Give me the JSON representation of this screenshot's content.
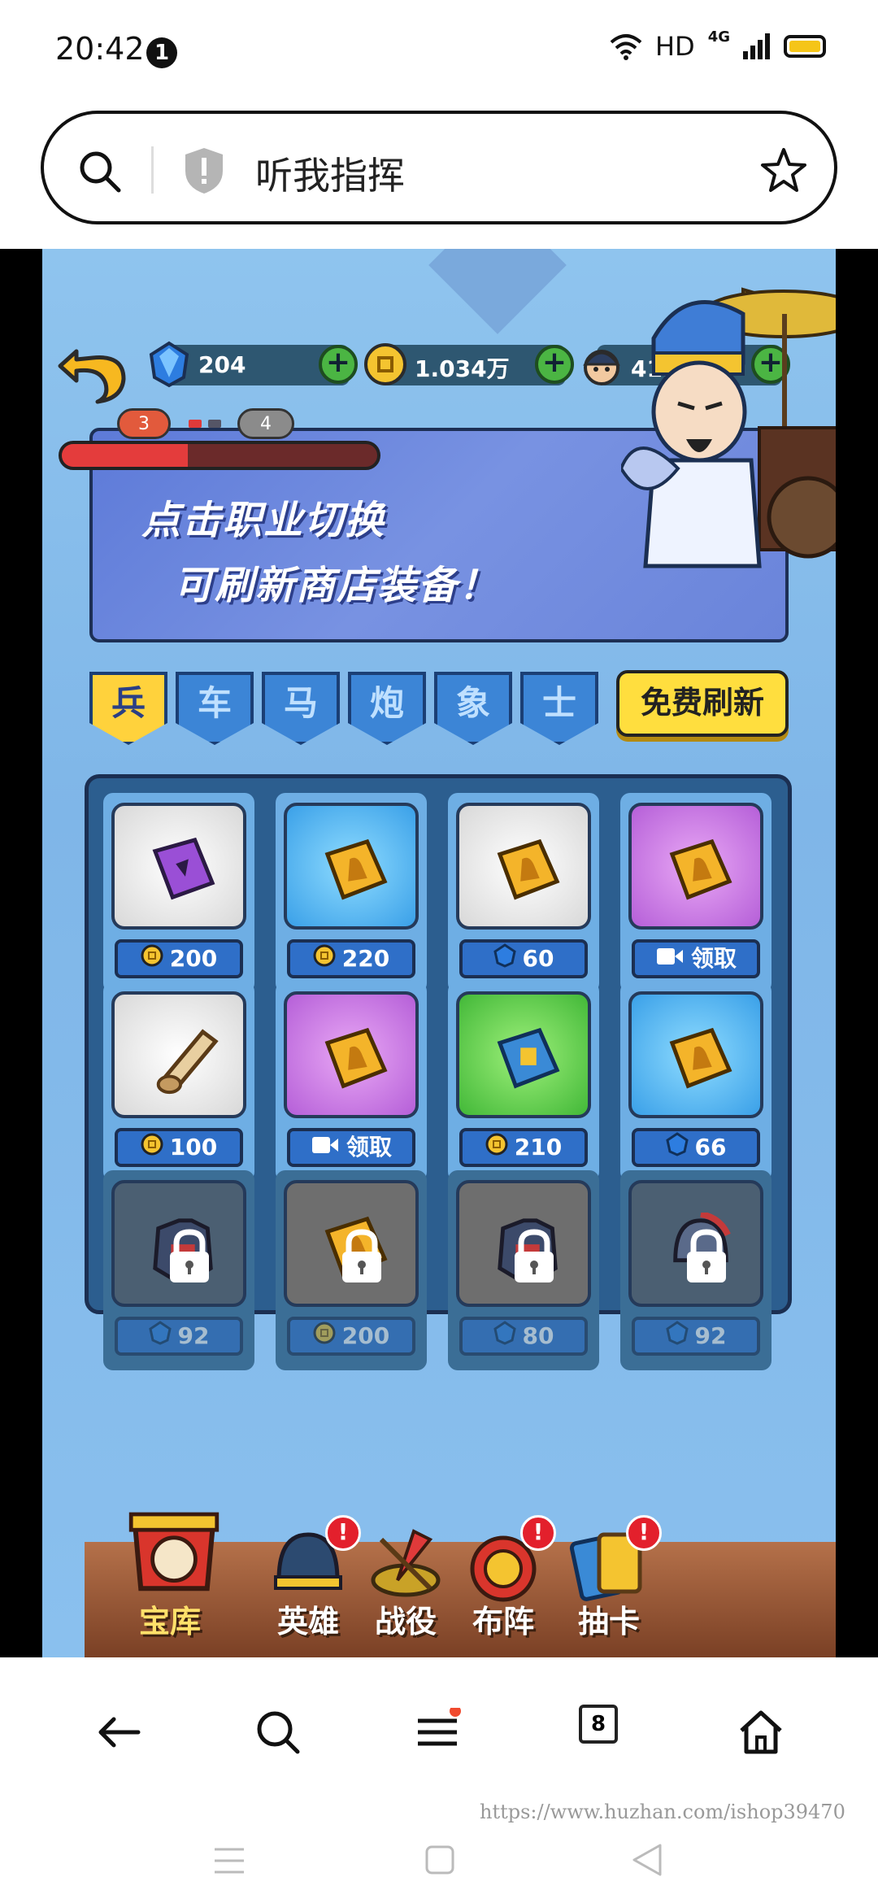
{
  "status_bar": {
    "time": "20:42",
    "notif_count": "1",
    "network": "HD",
    "signal": "4G"
  },
  "search_bar": {
    "url_text": "听我指挥"
  },
  "game": {
    "resources": [
      {
        "icon": "gem-icon",
        "value": "204"
      },
      {
        "icon": "coin-icon",
        "value": "1.034万"
      },
      {
        "icon": "soldier-icon",
        "value": "41.7万"
      }
    ],
    "progress": {
      "left_level": "3",
      "right_level": "4",
      "fill_fraction": 0.4
    },
    "banner": {
      "line1": "点击职业切换",
      "line2": "可刷新商店装备！"
    },
    "tabs": [
      "兵",
      "车",
      "马",
      "炮",
      "象",
      "士"
    ],
    "free_refresh": "免费刷新",
    "items": [
      {
        "frame": "white",
        "item": "purple-book",
        "currency": "coin",
        "price": "200",
        "locked": false
      },
      {
        "frame": "blue",
        "item": "gold-book",
        "currency": "coin",
        "price": "220",
        "locked": false
      },
      {
        "frame": "white",
        "item": "gold-book",
        "currency": "gem",
        "price": "60",
        "locked": false
      },
      {
        "frame": "purple",
        "item": "gold-book",
        "currency": "video",
        "price": "领取",
        "locked": false
      },
      {
        "frame": "white",
        "item": "scroll",
        "currency": "coin",
        "price": "100",
        "locked": false
      },
      {
        "frame": "purple",
        "item": "gold-book",
        "currency": "video",
        "price": "领取",
        "locked": false
      },
      {
        "frame": "green",
        "item": "blue-book",
        "currency": "coin",
        "price": "210",
        "locked": false
      },
      {
        "frame": "blue",
        "item": "gold-book",
        "currency": "gem",
        "price": "66",
        "locked": false
      },
      {
        "frame": "dark",
        "item": "armor",
        "currency": "gem",
        "price": "92",
        "locked": true
      },
      {
        "frame": "gray",
        "item": "gold-book",
        "currency": "coin",
        "price": "200",
        "locked": true
      },
      {
        "frame": "gray",
        "item": "armor",
        "currency": "gem",
        "price": "80",
        "locked": true
      },
      {
        "frame": "dark",
        "item": "helmet",
        "currency": "gem",
        "price": "92",
        "locked": true
      }
    ],
    "bottom_nav": [
      {
        "label": "宝库",
        "active": true,
        "badge": false
      },
      {
        "label": "英雄",
        "active": false,
        "badge": true
      },
      {
        "label": "战役",
        "active": false,
        "badge": false
      },
      {
        "label": "布阵",
        "active": false,
        "badge": true
      },
      {
        "label": "抽卡",
        "active": false,
        "badge": true
      }
    ],
    "badge_text": "!"
  },
  "browser_bar": {
    "tab_count": "8"
  },
  "watermark": "https://www.huzhan.com/ishop39470",
  "colors": {
    "accent_yellow": "#ffde3e",
    "tab_blue": "#3c85d6",
    "price_blue": "#2f6fc8"
  }
}
